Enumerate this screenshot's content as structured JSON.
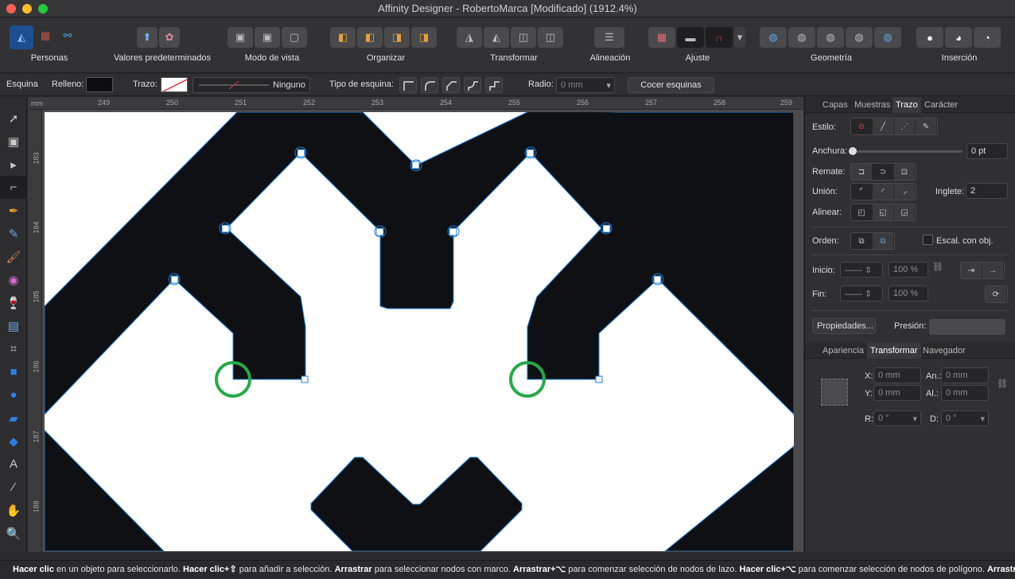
{
  "window": {
    "title": "Affinity Designer - RobertoMarca [Modificado] (1912.4%)"
  },
  "toolbar": {
    "groups": [
      {
        "label": "Personas"
      },
      {
        "label": "Valores predeterminados"
      },
      {
        "label": "Modo de vista"
      },
      {
        "label": "Organizar"
      },
      {
        "label": "Transformar"
      },
      {
        "label": "Alineación"
      },
      {
        "label": "Ajuste"
      },
      {
        "label": "Geometría"
      },
      {
        "label": "Inserción"
      }
    ]
  },
  "context": {
    "esquina": "Esquina",
    "relleno": "Relleno:",
    "trazo": "Trazo:",
    "stroke_name": "Ninguno",
    "tipo_esquina": "Tipo de esquina:",
    "radio": "Radio:",
    "radio_value": "0 mm",
    "cocer": "Cocer esquinas"
  },
  "rulers": {
    "unit": "mm",
    "top": [
      "249",
      "250",
      "251",
      "252",
      "253",
      "254",
      "255",
      "256",
      "257",
      "258",
      "259"
    ],
    "left": [
      "183",
      "184",
      "185",
      "186",
      "187",
      "188"
    ]
  },
  "panel_top": {
    "tabs": [
      "Capas",
      "Muestras",
      "Trazo",
      "Carácter"
    ],
    "estilo": "Estilo:",
    "anchura": "Anchura:",
    "anchura_value": "0 pt",
    "remate": "Remate:",
    "union": "Unión:",
    "inglete": "Inglete:",
    "inglete_value": "2",
    "alinear": "Alinear:",
    "orden": "Orden:",
    "escal": "Escal. con obj.",
    "inicio": "Inicio:",
    "fin": "Fin:",
    "pct1": "100 %",
    "pct2": "100 %",
    "propiedades": "Propiedades...",
    "presion": "Presión:"
  },
  "panel_bottom": {
    "tabs": [
      "Apariencia",
      "Transformar",
      "Navegador"
    ],
    "x": "X:",
    "x_value": "0 mm",
    "an": "An.:",
    "an_value": "0 mm",
    "y": "Y:",
    "y_value": "0 mm",
    "al": "Al.:",
    "al_value": "0 mm",
    "r": "R:",
    "r_value": "0 °",
    "d": "D:",
    "d_value": "0 °"
  },
  "status": {
    "p1": "Hacer clic",
    "t1": " en un objeto para seleccionarlo. ",
    "p2": "Hacer clic+⇧",
    "t2": " para añadir a selección. ",
    "p3": "Arrastrar",
    "t3": " para seleccionar nodos con marco. ",
    "p4": "Arrastrar+⌥",
    "t4": " para comenzar selección de nodos de lazo. ",
    "p5": "Hacer clic+⌥",
    "t5": " para comenzar selección de nodos de polígono. ",
    "p6": "Arrastrar+"
  },
  "colors": {
    "accent": "#1e7cd6",
    "highlight_circle": "#2aa84a",
    "fill": "#0f1013"
  }
}
